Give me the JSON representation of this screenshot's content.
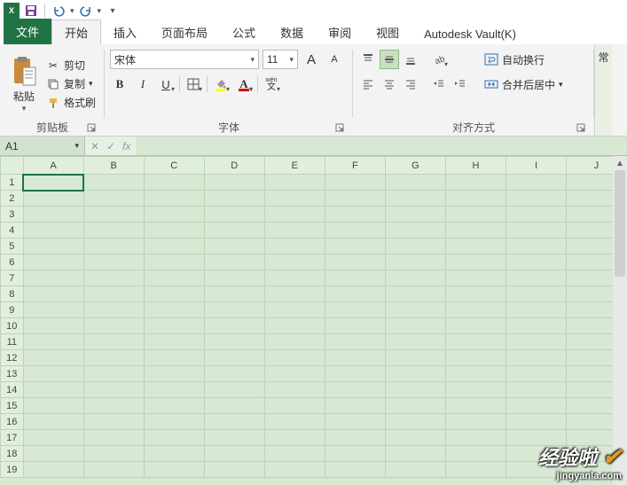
{
  "qat": {
    "app_label": "X",
    "undo_dd": "▾",
    "redo_dd": "▾"
  },
  "tabs": {
    "file": "文件",
    "home": "开始",
    "insert": "插入",
    "layout": "页面布局",
    "formulas": "公式",
    "data": "数据",
    "review": "审阅",
    "view": "视图",
    "vault": "Autodesk Vault(K)"
  },
  "clipboard": {
    "paste": "粘贴",
    "cut": "剪切",
    "copy": "复制",
    "format_painter": "格式刷",
    "group_label": "剪贴板"
  },
  "font": {
    "name": "宋体",
    "size": "11",
    "increase": "A",
    "decrease": "A",
    "bold": "B",
    "italic": "I",
    "underline": "U",
    "phonetic": "wén",
    "group_label": "字体"
  },
  "align": {
    "wrap": "自动换行",
    "merge": "合并后居中",
    "group_label": "对齐方式"
  },
  "right_group": {
    "label": "常"
  },
  "name_box": {
    "value": "A1"
  },
  "fx": {
    "label": "fx"
  },
  "grid": {
    "columns": [
      "A",
      "B",
      "C",
      "D",
      "E",
      "F",
      "G",
      "H",
      "I",
      "J"
    ],
    "rows": [
      1,
      2,
      3,
      4,
      5,
      6,
      7,
      8,
      9,
      10,
      11,
      12,
      13,
      14,
      15,
      16,
      17,
      18,
      19
    ],
    "selected": "A1"
  },
  "watermark": {
    "line1": "经验啦",
    "line2": "jingyanla.com"
  }
}
